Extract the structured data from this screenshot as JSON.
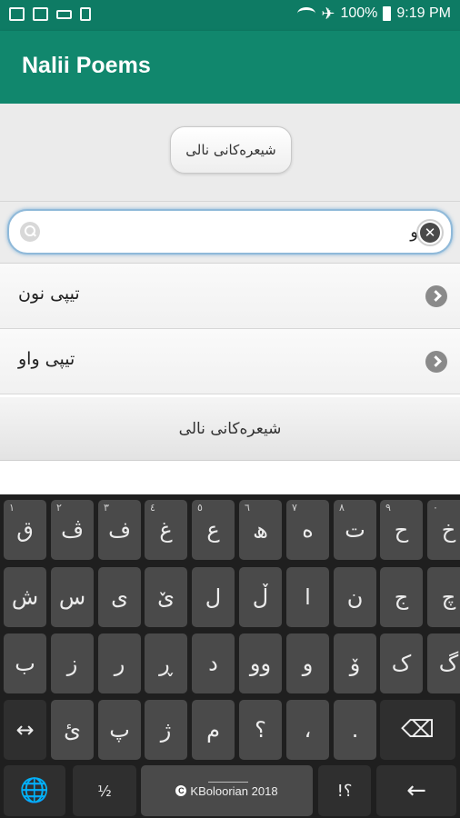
{
  "status_bar": {
    "battery": "100%",
    "time": "9:19 PM",
    "icons": [
      "gallery-icon",
      "activity-icon",
      "voicemail-icon",
      "sd-card-icon",
      "wifi-icon",
      "airplane-icon",
      "battery-icon"
    ]
  },
  "app_bar": {
    "title": "Nalii Poems"
  },
  "header": {
    "button_label": "شیعرەکانی نالی"
  },
  "search": {
    "value": "و",
    "clear_label": "✕"
  },
  "list": {
    "items": [
      {
        "label": "تیپی نون"
      },
      {
        "label": "تیپی واو"
      }
    ]
  },
  "footer": {
    "label": "شیعرەکانی نالی"
  },
  "keyboard": {
    "row1": [
      {
        "key": "ق",
        "hint": "١"
      },
      {
        "key": "ڤ",
        "hint": "٢"
      },
      {
        "key": "ف",
        "hint": "٣"
      },
      {
        "key": "غ",
        "hint": "٤"
      },
      {
        "key": "ع",
        "hint": "٥"
      },
      {
        "key": "ھ",
        "hint": "٦"
      },
      {
        "key": "ە",
        "hint": "٧"
      },
      {
        "key": "ت",
        "hint": "٨"
      },
      {
        "key": "ح",
        "hint": "٩"
      },
      {
        "key": "خ",
        "hint": "٠"
      }
    ],
    "row2": [
      "ش",
      "س",
      "ی",
      "ێ",
      "ل",
      "ڵ",
      "ا",
      "ن",
      "ج",
      "چ"
    ],
    "row3": [
      "ب",
      "ز",
      "ر",
      "ڕ",
      "د",
      "وو",
      "و",
      "ۆ",
      "ک",
      "گ"
    ],
    "row4": [
      "↔",
      "ئ",
      "پ",
      "ژ",
      "م",
      "؟",
      "،",
      "."
    ],
    "row4_delete": "⌫",
    "row5": {
      "globe": "🌐",
      "numbers": "½",
      "space": "KBoloorian 2018",
      "copyright": "C",
      "punct": "؟!",
      "enter": "←"
    }
  }
}
